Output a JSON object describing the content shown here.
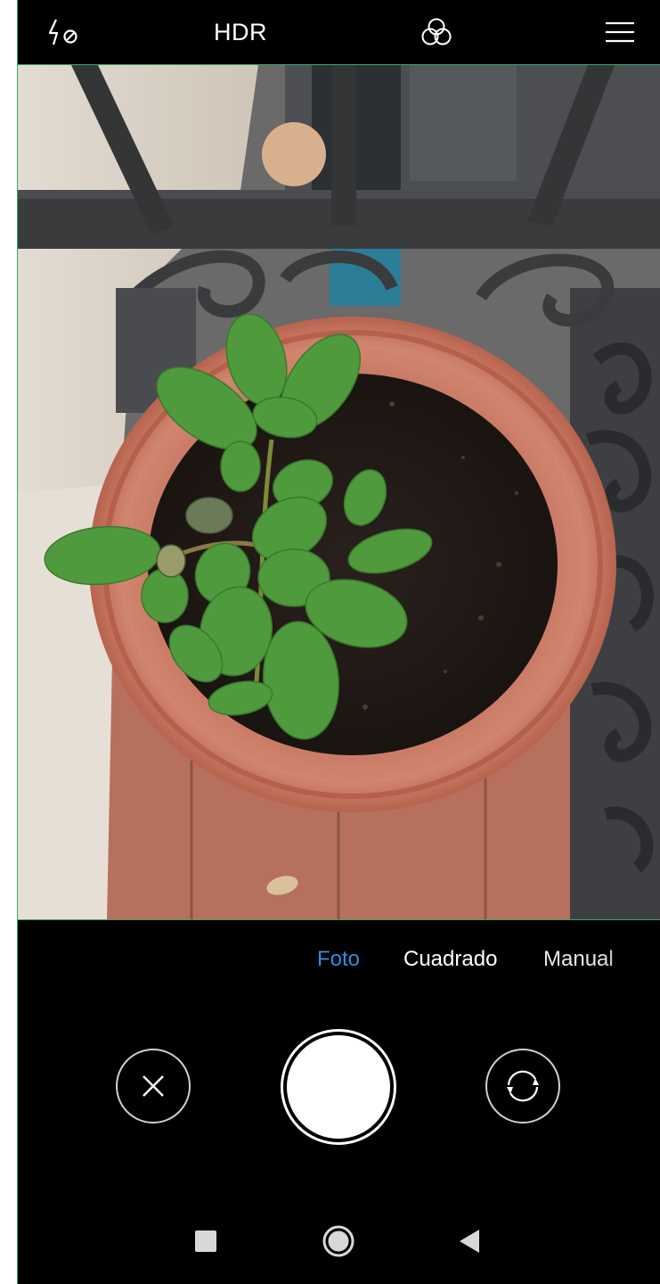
{
  "topbar": {
    "flash_icon": "flash-off-icon",
    "hdr_label": "HDR",
    "filters_icon": "filters-icon",
    "menu_icon": "hamburger-menu-icon"
  },
  "viewfinder": {
    "subject": "live camera preview",
    "border_color": "#3aa56a"
  },
  "modes": {
    "items": [
      "Foto",
      "Cuadrado",
      "Manual"
    ],
    "selected": "Foto",
    "selected_color": "#2f8fe0"
  },
  "controls": {
    "cancel_icon": "close-icon",
    "shutter_icon": "shutter-button",
    "switch_icon": "switch-camera-icon"
  },
  "navbar": {
    "recent_icon": "recent-apps-icon",
    "home_icon": "home-icon",
    "back_icon": "back-icon"
  },
  "colors": {
    "background": "#000000",
    "foreground": "#ffffff",
    "accent": "#2f8fe0"
  }
}
